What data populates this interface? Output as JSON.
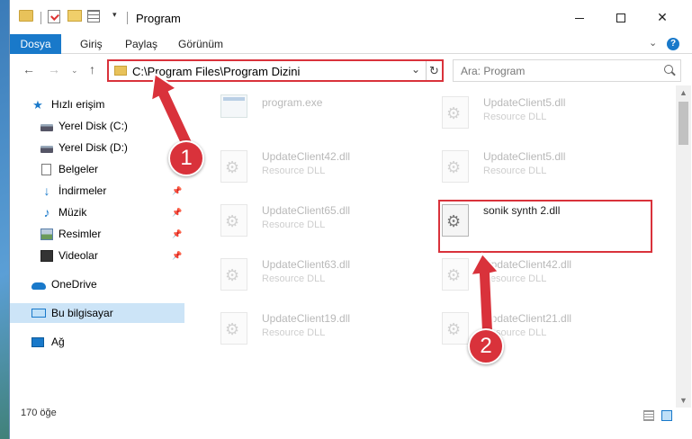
{
  "window": {
    "title": "Program",
    "colors": {
      "accent": "#1979ca",
      "highlight": "#d9323b",
      "selected_bg": "#cce4f7"
    }
  },
  "quick_access": {
    "dropdown_glyph": "▾"
  },
  "ribbon": {
    "tabs": [
      "Dosya",
      "Giriş",
      "Paylaş",
      "Görünüm"
    ],
    "expand_glyph": "⌄",
    "help_glyph": "?"
  },
  "nav": {
    "back_glyph": "←",
    "forward_glyph": "→",
    "recent_glyph": "⌄",
    "up_glyph": "↑",
    "address": "C:\\Program Files\\Program Dizini",
    "address_drop_glyph": "⌄",
    "refresh_glyph": "↻",
    "search_placeholder": "Ara: Program"
  },
  "sidebar": {
    "items": [
      {
        "label": "Hızlı erişim",
        "icon": "star-icon"
      },
      {
        "label": "Yerel Disk (C:)",
        "icon": "drive-icon"
      },
      {
        "label": "Yerel Disk (D:)",
        "icon": "drive-icon"
      },
      {
        "label": "Belgeler",
        "icon": "documents-icon"
      },
      {
        "label": "İndirmeler",
        "icon": "download-icon",
        "pinned": true
      },
      {
        "label": "Müzik",
        "icon": "music-icon",
        "pinned": true
      },
      {
        "label": "Resimler",
        "icon": "pictures-icon",
        "pinned": true
      },
      {
        "label": "Videolar",
        "icon": "videos-icon",
        "pinned": true
      },
      {
        "label": "OneDrive",
        "icon": "onedrive-icon"
      },
      {
        "label": "Bu bilgisayar",
        "icon": "computer-icon",
        "selected": true
      },
      {
        "label": "Ağ",
        "icon": "network-icon"
      }
    ],
    "pin_glyph": "📌"
  },
  "files": [
    {
      "name": "program.exe",
      "type": "",
      "faded": true
    },
    {
      "name": "UpdateClient5.dll",
      "type": "Resource DLL",
      "faded": true
    },
    {
      "name": "UpdateClient42.dll",
      "type": "Resource DLL",
      "faded": true
    },
    {
      "name": "UpdateClient5.dll",
      "type": "Resource DLL",
      "faded": true
    },
    {
      "name": "UpdateClient65.dll",
      "type": "Resource DLL",
      "faded": true
    },
    {
      "name": "sonik synth 2.dll",
      "type": "",
      "faded": false
    },
    {
      "name": "UpdateClient63.dll",
      "type": "Resource DLL",
      "faded": true
    },
    {
      "name": "UpdateClient42.dll",
      "type": "Resource DLL",
      "faded": true
    },
    {
      "name": "UpdateClient19.dll",
      "type": "Resource DLL",
      "faded": true
    },
    {
      "name": "UpdateClient21.dll",
      "type": "Resource DLL",
      "faded": true
    }
  ],
  "scrollbar": {
    "up_glyph": "▲",
    "down_glyph": "▼"
  },
  "status": {
    "item_count": "170 öğe"
  },
  "annotations": {
    "callout_1": "1",
    "callout_2": "2"
  }
}
